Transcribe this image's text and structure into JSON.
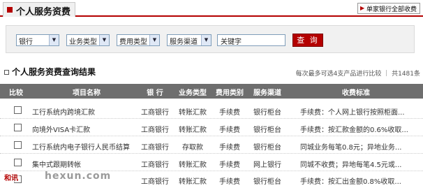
{
  "header": {
    "title": "个人服务资费",
    "all_link": "单家银行全部收费"
  },
  "filters": {
    "bank": "银行",
    "service_type": "业务类型",
    "fee_type": "费用类型",
    "channel": "服务渠道",
    "keyword": "关键字",
    "query_button": "查 询"
  },
  "results": {
    "title": "个人服务资费查询结果",
    "hint": "每次最多可选4支产品进行比较 ｜ 共1481条"
  },
  "table": {
    "headers": [
      "比较",
      "项目名称",
      "银 行",
      "业务类型",
      "费用类别",
      "服务渠道",
      "收费标准"
    ],
    "rows": [
      {
        "name": "工行系统内跨境汇款",
        "bank": "工商银行",
        "type": "转账汇款",
        "fee": "手续费",
        "channel": "银行柜台",
        "standard": "手续费：个人网上银行按照柜面..."
      },
      {
        "name": "向境外VISA卡汇款",
        "bank": "工商银行",
        "type": "转账汇款",
        "fee": "手续费",
        "channel": "银行柜台",
        "standard": "手续费：按汇款金额的0.6%收取..."
      },
      {
        "name": "工行系统内电子银行人民币结算",
        "bank": "工商银行",
        "type": "存取款",
        "fee": "手续费",
        "channel": "银行柜台",
        "standard": "同城业务每笔0.8元；异地业务..."
      },
      {
        "name": "集中式跟期转帐",
        "bank": "工商银行",
        "type": "转账汇款",
        "fee": "手续费",
        "channel": "网上银行",
        "standard": "同城不收费；异地每笔4.5元或..."
      },
      {
        "name": "",
        "bank": "工商银行",
        "type": "转账汇款",
        "fee": "手续费",
        "channel": "银行柜台",
        "standard": "手续费：按汇出金额0.8%收取..."
      }
    ]
  },
  "watermark": {
    "logo": "和讯",
    "site": "hexun.com"
  }
}
